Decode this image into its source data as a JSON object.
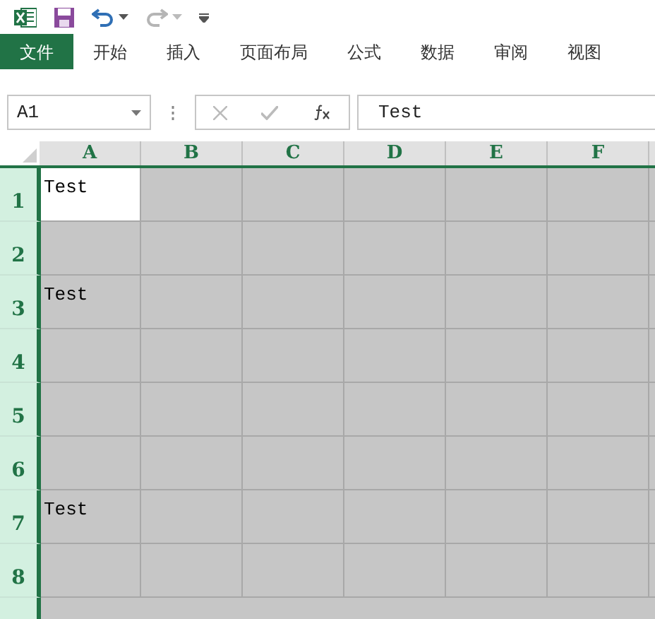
{
  "ribbon_tabs": [
    {
      "label": "文件",
      "selected": true
    },
    {
      "label": "开始",
      "selected": false
    },
    {
      "label": "插入",
      "selected": false
    },
    {
      "label": "页面布局",
      "selected": false
    },
    {
      "label": "公式",
      "selected": false
    },
    {
      "label": "数据",
      "selected": false
    },
    {
      "label": "审阅",
      "selected": false
    },
    {
      "label": "视图",
      "selected": false
    }
  ],
  "formula_bar": {
    "name_box": "A1",
    "formula": "Test"
  },
  "columns": [
    {
      "label": "A",
      "selected": true
    },
    {
      "label": "B",
      "selected": true
    },
    {
      "label": "C",
      "selected": true
    },
    {
      "label": "D",
      "selected": true
    },
    {
      "label": "E",
      "selected": true
    },
    {
      "label": "F",
      "selected": true
    }
  ],
  "rows": [
    {
      "label": "1",
      "selected": true,
      "cells": [
        {
          "text": "Test",
          "active": true
        },
        {
          "active": false
        },
        {
          "active": false
        },
        {
          "active": false
        },
        {
          "active": false
        },
        {
          "active": false
        }
      ]
    },
    {
      "label": "2",
      "selected": true,
      "cells": [
        {
          "active": false
        },
        {
          "active": false
        },
        {
          "active": false
        },
        {
          "active": false
        },
        {
          "active": false
        },
        {
          "active": false
        }
      ]
    },
    {
      "label": "3",
      "selected": true,
      "cells": [
        {
          "text": "Test",
          "active": false
        },
        {
          "active": false
        },
        {
          "active": false
        },
        {
          "active": false
        },
        {
          "active": false
        },
        {
          "active": false
        }
      ]
    },
    {
      "label": "4",
      "selected": true,
      "cells": [
        {
          "active": false
        },
        {
          "active": false
        },
        {
          "active": false
        },
        {
          "active": false
        },
        {
          "active": false
        },
        {
          "active": false
        }
      ]
    },
    {
      "label": "5",
      "selected": true,
      "cells": [
        {
          "active": false
        },
        {
          "active": false
        },
        {
          "active": false
        },
        {
          "active": false
        },
        {
          "active": false
        },
        {
          "active": false
        }
      ]
    },
    {
      "label": "6",
      "selected": true,
      "cells": [
        {
          "active": false
        },
        {
          "active": false
        },
        {
          "active": false
        },
        {
          "active": false
        },
        {
          "active": false
        },
        {
          "active": false
        }
      ]
    },
    {
      "label": "7",
      "selected": true,
      "cells": [
        {
          "text": "Test",
          "active": false
        },
        {
          "active": false
        },
        {
          "active": false
        },
        {
          "active": false
        },
        {
          "active": false
        },
        {
          "active": false
        }
      ]
    },
    {
      "label": "8",
      "selected": true,
      "cells": [
        {
          "active": false
        },
        {
          "active": false
        },
        {
          "active": false
        },
        {
          "active": false
        },
        {
          "active": false
        },
        {
          "active": false
        }
      ]
    }
  ]
}
